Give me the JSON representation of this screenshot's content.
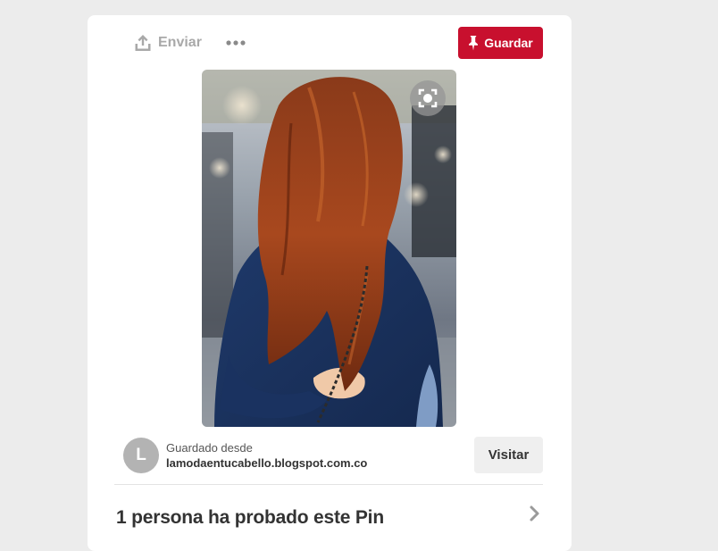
{
  "toolbar": {
    "send_label": "Enviar",
    "send_icon": "share-upload-icon",
    "more_icon": "more-dots-icon",
    "save_label": "Guardar",
    "save_icon": "pushpin-icon"
  },
  "pin": {
    "image_alt": "photo-woman-long-auburn-hair",
    "zoom_icon": "expand-zoom-icon"
  },
  "source": {
    "avatar_letter": "L",
    "saved_from_label": "Guardado desde",
    "domain": "lamodaentucabello.blogspot.com.co",
    "visit_label": "Visitar"
  },
  "tried": {
    "title": "1 persona ha probado este Pin",
    "chevron_icon": "chevron-right-icon"
  },
  "colors": {
    "background": "#ececec",
    "card": "#ffffff",
    "save_red": "#c8102e",
    "muted_gray": "#a9a9a9",
    "visit_button": "#efefef"
  }
}
